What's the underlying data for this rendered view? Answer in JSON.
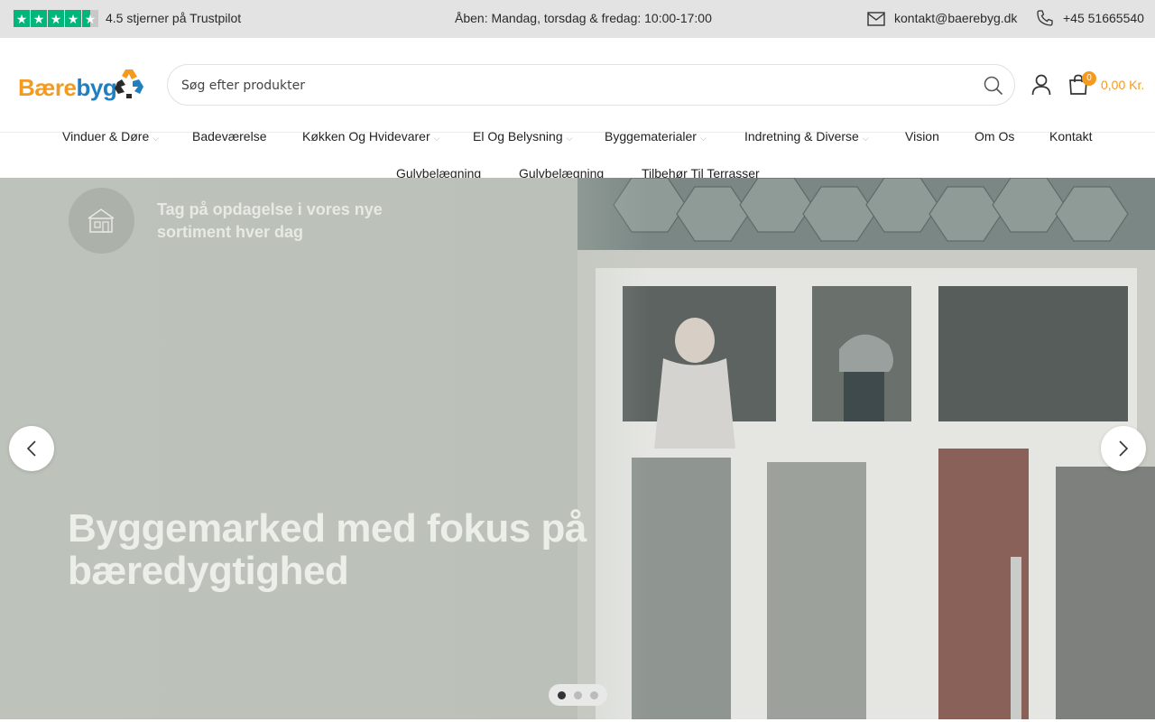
{
  "topbar": {
    "trustpilot_text": "4.5 stjerner på Trustpilot",
    "hours": "Åben: Mandag, torsdag & fredag: 10:00-17:00",
    "email": "kontakt@baerebyg.dk",
    "phone": "+45 51665540"
  },
  "header": {
    "logo_part1": "Bære",
    "logo_part2": "byg",
    "search_placeholder": "Søg efter produkter",
    "cart_count": "0",
    "cart_total": "0,00 Kr."
  },
  "nav": {
    "items": [
      {
        "label": "Vinduer & Døre",
        "dropdown": true
      },
      {
        "label": "Badeværelse",
        "dropdown": false
      },
      {
        "label": "Køkken Og Hvidevarer",
        "dropdown": true
      },
      {
        "label": "El Og Belysning",
        "dropdown": true
      },
      {
        "label": "Byggematerialer",
        "dropdown": true
      },
      {
        "label": "Indretning & Diverse",
        "dropdown": true
      },
      {
        "label": "Vision",
        "dropdown": false
      },
      {
        "label": "Om Os",
        "dropdown": false
      },
      {
        "label": "Kontakt",
        "dropdown": false
      },
      {
        "label": "Gulvbelægning",
        "dropdown": false
      },
      {
        "label": "Gulvbelægning",
        "dropdown": false
      },
      {
        "label": "Tilbehør Til Terrasser",
        "dropdown": false
      }
    ]
  },
  "hero": {
    "feature_text": "Tag på opdagelse i vores nye sortiment hver dag",
    "heading": "Byggemarked med fokus på bæredygtighed",
    "slide_count": 3,
    "active_slide": 1
  },
  "colors": {
    "brand_orange": "#f39a1f",
    "brand_blue": "#1f7fc1",
    "trustpilot_green": "#00b67a"
  }
}
